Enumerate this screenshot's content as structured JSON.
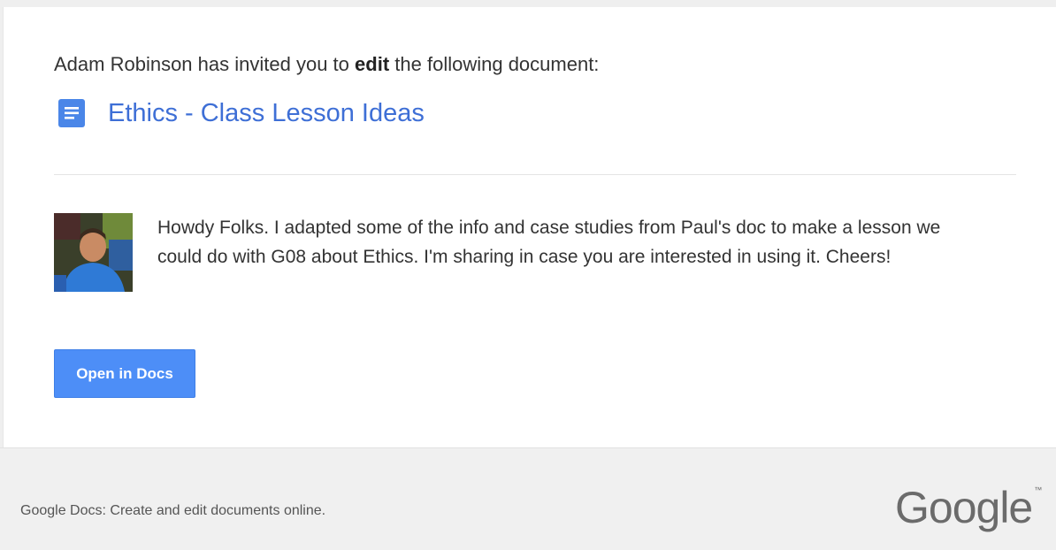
{
  "invite": {
    "sender": "Adam Robinson",
    "text_before": "has invited you to",
    "permission": "edit",
    "text_after": "the following document:"
  },
  "document": {
    "title": "Ethics - Class Lesson Ideas",
    "icon": "google-docs-icon",
    "link_color": "#3e6fd6"
  },
  "message": {
    "avatar": "sender-avatar-photo",
    "text": "Howdy Folks. I adapted some of the info and case studies from Paul's doc to make a lesson we could do with G08 about Ethics. I'm sharing in case you are interested in using it. Cheers!"
  },
  "action": {
    "open_label": "Open in Docs",
    "button_color": "#4d8ef7"
  },
  "footer": {
    "tagline": "Google Docs: Create and edit documents online.",
    "logo_text": "Google",
    "logo_mark": "™"
  }
}
